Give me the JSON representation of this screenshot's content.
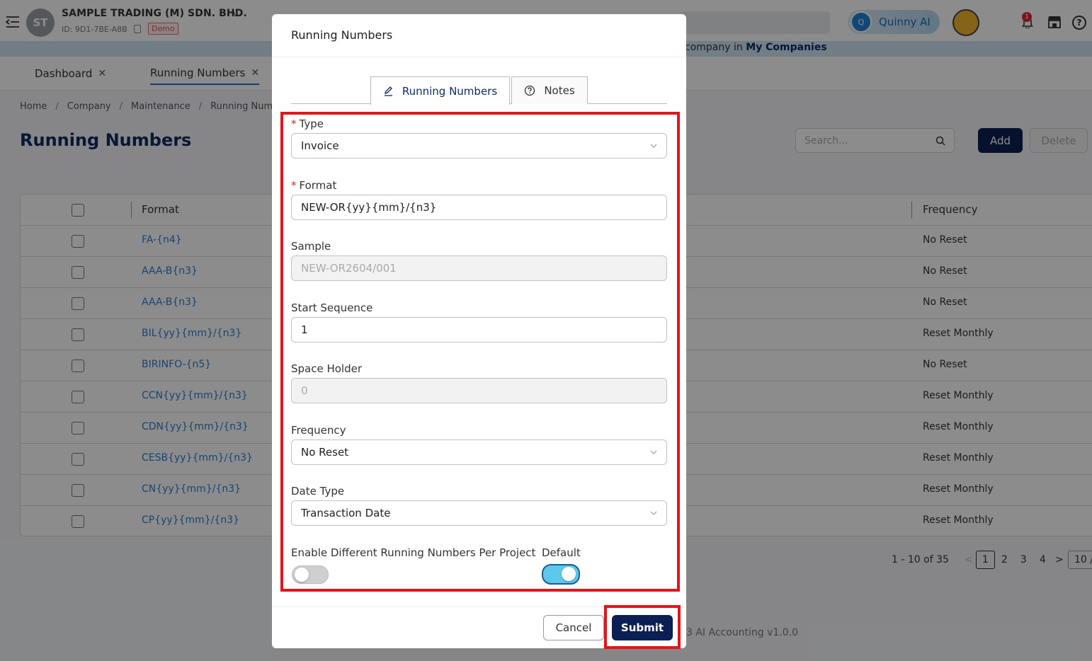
{
  "header": {
    "company_name": "SAMPLE TRADING (M) SDN. BHD.",
    "company_initials": "ST",
    "company_id": "ID: 9D1-7BE-A8B",
    "demo_badge": "Demo",
    "assistant_label": "Quinny AI",
    "notification_count": "1"
  },
  "banner": {
    "text_prefix": "company in ",
    "link_text": "My Companies"
  },
  "app_tabs": [
    {
      "label": "Dashboard"
    },
    {
      "label": "Running Numbers"
    }
  ],
  "breadcrumb": [
    "Home",
    "Company",
    "Maintenance",
    "Running Num"
  ],
  "page": {
    "title": "Running Numbers",
    "search_placeholder": "Search...",
    "add_label": "Add",
    "delete_label": "Delete"
  },
  "table": {
    "columns": {
      "format": "Format",
      "frequency": "Frequency"
    },
    "rows": [
      {
        "format": "FA-{n4}",
        "frequency": "No Reset"
      },
      {
        "format": "AAA-B{n3}",
        "frequency": "No Reset"
      },
      {
        "format": "AAA-B{n3}",
        "frequency": "No Reset"
      },
      {
        "format": "BIL{yy}{mm}/{n3}",
        "frequency": "Reset Monthly"
      },
      {
        "format": "BIRINFO-{n5}",
        "frequency": "No Reset"
      },
      {
        "format": "CCN{yy}{mm}/{n3}",
        "frequency": "Reset Monthly"
      },
      {
        "format": "CDN{yy}{mm}/{n3}",
        "frequency": "Reset Monthly"
      },
      {
        "format": "CESB{yy}{mm}/{n3}",
        "frequency": "Reset Monthly"
      },
      {
        "format": "CN{yy}{mm}/{n3}",
        "frequency": "Reset Monthly"
      },
      {
        "format": "CP{yy}{mm}/{n3}",
        "frequency": "Reset Monthly"
      }
    ]
  },
  "pagination": {
    "info": "1 - 10 of 35",
    "pages": [
      "1",
      "2",
      "3",
      "4"
    ],
    "current": "1",
    "page_size": "10 /"
  },
  "footer": {
    "text": "3 AI Accounting v1.0.0"
  },
  "modal": {
    "title": "Running Numbers",
    "tabs": [
      {
        "label": "Running Numbers",
        "icon": "edit-icon"
      },
      {
        "label": "Notes",
        "icon": "help-circle-icon"
      }
    ],
    "fields": {
      "type": {
        "label": "Type",
        "value": "Invoice"
      },
      "format": {
        "label": "Format",
        "value": "NEW-OR{yy}{mm}/{n3}"
      },
      "sample": {
        "label": "Sample",
        "value": "NEW-OR2604/001"
      },
      "start_sequence": {
        "label": "Start Sequence",
        "value": "1"
      },
      "space_holder": {
        "label": "Space Holder",
        "value": "0"
      },
      "frequency": {
        "label": "Frequency",
        "value": "No Reset"
      },
      "date_type": {
        "label": "Date Type",
        "value": "Transaction Date"
      },
      "per_project": {
        "label": "Enable Different Running Numbers Per Project",
        "enabled": false
      },
      "default": {
        "label": "Default",
        "enabled": true
      }
    },
    "cancel_label": "Cancel",
    "submit_label": "Submit"
  },
  "colors": {
    "primary_navy": "#0c1f55",
    "link_blue": "#2a7fd0",
    "highlight_red": "#e5141b",
    "toggle_on": "#5ec8ec"
  }
}
